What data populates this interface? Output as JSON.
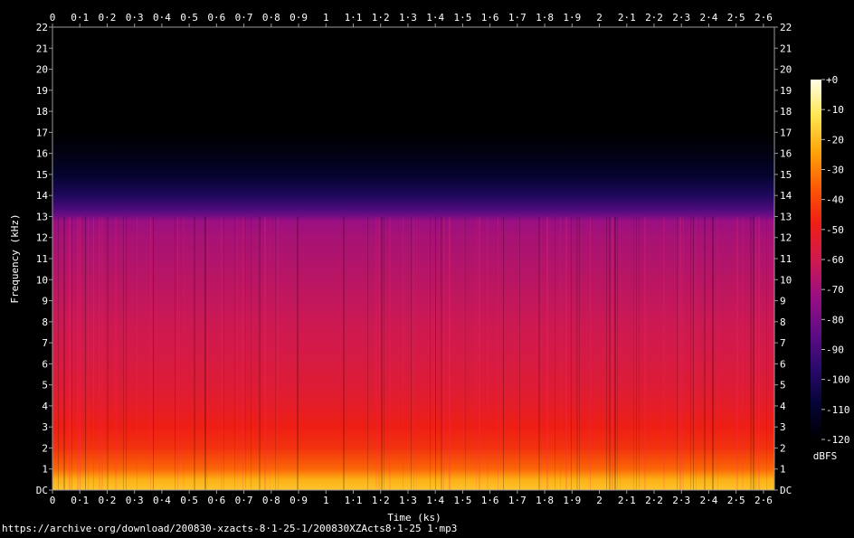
{
  "chart_data": {
    "type": "heatmap",
    "title": "",
    "xlabel": "Time (ks)",
    "ylabel": "Frequency (kHz)",
    "xlim": [
      0,
      2.64
    ],
    "ylim": [
      0,
      22
    ],
    "x_ticks": [
      {
        "v": 0,
        "label": "0"
      },
      {
        "v": 0.1,
        "label": "0·1"
      },
      {
        "v": 0.2,
        "label": "0·2"
      },
      {
        "v": 0.3,
        "label": "0·3"
      },
      {
        "v": 0.4,
        "label": "0·4"
      },
      {
        "v": 0.5,
        "label": "0·5"
      },
      {
        "v": 0.6,
        "label": "0·6"
      },
      {
        "v": 0.7,
        "label": "0·7"
      },
      {
        "v": 0.8,
        "label": "0·8"
      },
      {
        "v": 0.9,
        "label": "0·9"
      },
      {
        "v": 1.0,
        "label": "1"
      },
      {
        "v": 1.1,
        "label": "1·1"
      },
      {
        "v": 1.2,
        "label": "1·2"
      },
      {
        "v": 1.3,
        "label": "1·3"
      },
      {
        "v": 1.4,
        "label": "1·4"
      },
      {
        "v": 1.5,
        "label": "1·5"
      },
      {
        "v": 1.6,
        "label": "1·6"
      },
      {
        "v": 1.7,
        "label": "1·7"
      },
      {
        "v": 1.8,
        "label": "1·8"
      },
      {
        "v": 1.9,
        "label": "1·9"
      },
      {
        "v": 2.0,
        "label": "2"
      },
      {
        "v": 2.1,
        "label": "2·1"
      },
      {
        "v": 2.2,
        "label": "2·2"
      },
      {
        "v": 2.3,
        "label": "2·3"
      },
      {
        "v": 2.4,
        "label": "2·4"
      },
      {
        "v": 2.5,
        "label": "2·5"
      },
      {
        "v": 2.6,
        "label": "2·6"
      }
    ],
    "y_ticks": [
      {
        "v": 0,
        "label": "DC"
      },
      {
        "v": 1,
        "label": "1"
      },
      {
        "v": 2,
        "label": "2"
      },
      {
        "v": 3,
        "label": "3"
      },
      {
        "v": 4,
        "label": "4"
      },
      {
        "v": 5,
        "label": "5"
      },
      {
        "v": 6,
        "label": "6"
      },
      {
        "v": 7,
        "label": "7"
      },
      {
        "v": 8,
        "label": "8"
      },
      {
        "v": 9,
        "label": "9"
      },
      {
        "v": 10,
        "label": "10"
      },
      {
        "v": 11,
        "label": "11"
      },
      {
        "v": 12,
        "label": "12"
      },
      {
        "v": 13,
        "label": "13"
      },
      {
        "v": 14,
        "label": "14"
      },
      {
        "v": 15,
        "label": "15"
      },
      {
        "v": 16,
        "label": "16"
      },
      {
        "v": 17,
        "label": "17"
      },
      {
        "v": 18,
        "label": "18"
      },
      {
        "v": 19,
        "label": "19"
      },
      {
        "v": 20,
        "label": "20"
      },
      {
        "v": 21,
        "label": "21"
      },
      {
        "v": 22,
        "label": "22"
      }
    ],
    "colorbar": {
      "unit": "dBFS",
      "range": [
        -120,
        0
      ],
      "ticks": [
        {
          "v": 0,
          "label": "+0"
        },
        {
          "v": -10,
          "label": "-10"
        },
        {
          "v": -20,
          "label": "-20"
        },
        {
          "v": -30,
          "label": "-30"
        },
        {
          "v": -40,
          "label": "-40"
        },
        {
          "v": -50,
          "label": "-50"
        },
        {
          "v": -60,
          "label": "-60"
        },
        {
          "v": -70,
          "label": "-70"
        },
        {
          "v": -80,
          "label": "-80"
        },
        {
          "v": -90,
          "label": "-90"
        },
        {
          "v": -100,
          "label": "-100"
        },
        {
          "v": -110,
          "label": "-110"
        },
        {
          "v": -120,
          "label": "-120"
        }
      ],
      "colors": [
        "#000000",
        "#050436",
        "#2b0a6e",
        "#630c86",
        "#9a0f82",
        "#cf1a4f",
        "#ee1e14",
        "#fb5a06",
        "#fda40a",
        "#ffe650",
        "#ffffe8"
      ]
    },
    "spectrum_profile": {
      "freq_khz": [
        0,
        0.5,
        1,
        2,
        3,
        4,
        5,
        6,
        7,
        8,
        9,
        10,
        11,
        12,
        12.8,
        13,
        13.3,
        14,
        15,
        16,
        17,
        22
      ],
      "level_dbfs": [
        -18,
        -22,
        -34,
        -44,
        -48,
        -52,
        -55,
        -57,
        -59,
        -61,
        -63,
        -65,
        -67,
        -69,
        -72,
        -80,
        -88,
        -100,
        -110,
        -116,
        -120,
        -120
      ]
    },
    "grid": false
  },
  "footer": {
    "source": "https://archive·org/download/200830-xzacts-8·1-25-1/200830XZActs8·1-25 1·mp3"
  }
}
